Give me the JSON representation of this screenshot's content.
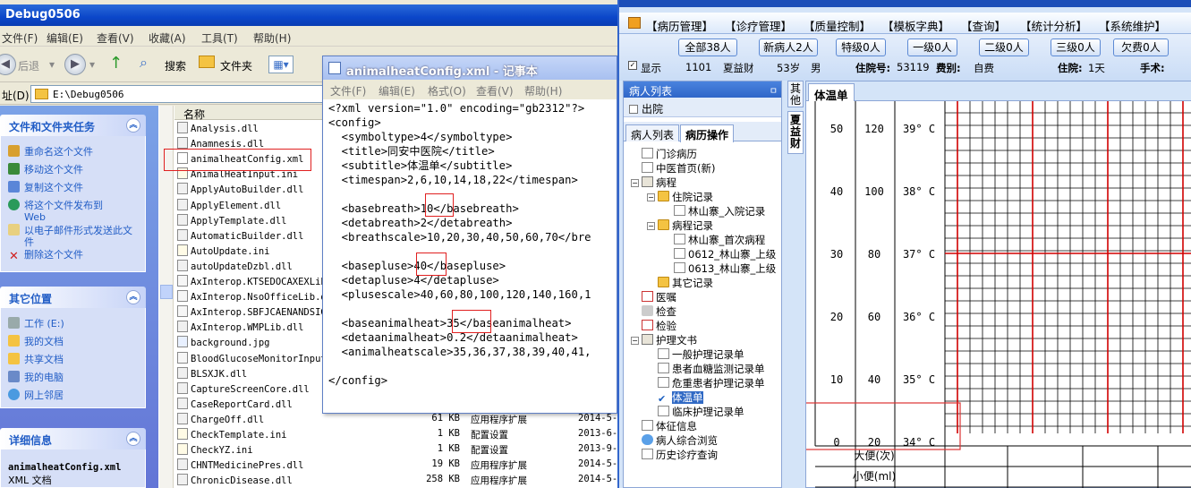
{
  "explorer": {
    "title": "Debug0506",
    "menu": [
      "文件(F)",
      "编辑(E)",
      "查看(V)",
      "收藏(A)",
      "工具(T)",
      "帮助(H)"
    ],
    "toolbar": {
      "back": "后退",
      "search": "搜索",
      "folders": "文件夹"
    },
    "address_label": "址(D)",
    "address": "E:\\Debug0506",
    "tasks": {
      "title": "文件和文件夹任务",
      "items": [
        "重命名这个文件",
        "移动这个文件",
        "复制这个文件",
        "将这个文件发布到Web",
        "以电子邮件形式发送此文件",
        "删除这个文件"
      ]
    },
    "places": {
      "title": "其它位置",
      "items": [
        "工作 (E:)",
        "我的文档",
        "共享文档",
        "我的电脑",
        "网上邻居"
      ]
    },
    "details": {
      "title": "详细信息",
      "filename": "animalheatConfig.xml",
      "filetype": "XML 文档"
    },
    "column_name": "名称",
    "files": [
      {
        "name": "Analysis.dll",
        "size": "",
        "type": "",
        "date": ""
      },
      {
        "name": "Anamnesis.dll",
        "size": "",
        "type": "",
        "date": ""
      },
      {
        "name": "animalheatConfig.xml",
        "size": "",
        "type": "",
        "date": ""
      },
      {
        "name": "AnimalHeatInput.ini",
        "size": "",
        "type": "",
        "date": ""
      },
      {
        "name": "ApplyAutoBuilder.dll",
        "size": "",
        "type": "",
        "date": ""
      },
      {
        "name": "ApplyElement.dll",
        "size": "",
        "type": "",
        "date": ""
      },
      {
        "name": "ApplyTemplate.dll",
        "size": "",
        "type": "",
        "date": ""
      },
      {
        "name": "AutomaticBuilder.dll",
        "size": "",
        "type": "",
        "date": ""
      },
      {
        "name": "AutoUpdate.ini",
        "size": "",
        "type": "",
        "date": ""
      },
      {
        "name": "autoUpdateDzbl.dll",
        "size": "",
        "type": "",
        "date": ""
      },
      {
        "name": "AxInterop.KTSEDOCAXEXLib",
        "size": "",
        "type": "",
        "date": ""
      },
      {
        "name": "AxInterop.NsoOfficeLib.d",
        "size": "",
        "type": "",
        "date": ""
      },
      {
        "name": "AxInterop.SBFJCAENANDSIG",
        "size": "",
        "type": "",
        "date": ""
      },
      {
        "name": "AxInterop.WMPLib.dll",
        "size": "",
        "type": "",
        "date": ""
      },
      {
        "name": "background.jpg",
        "size": "",
        "type": "",
        "date": ""
      },
      {
        "name": "BloodGlucoseMonitorInput",
        "size": "",
        "type": "",
        "date": ""
      },
      {
        "name": "BLSXJK.dll",
        "size": "",
        "type": "",
        "date": ""
      },
      {
        "name": "CaptureScreenCore.dll",
        "size": "",
        "type": "",
        "date": ""
      },
      {
        "name": "CaseReportCard.dll",
        "size": "",
        "type": "",
        "date": ""
      },
      {
        "name": "ChargeOff.dll",
        "size": "61 KB",
        "type": "应用程序扩展",
        "date": "2014-5-"
      },
      {
        "name": "CheckTemplate.ini",
        "size": "1 KB",
        "type": "配置设置",
        "date": "2013-6-"
      },
      {
        "name": "CheckYZ.ini",
        "size": "1 KB",
        "type": "配置设置",
        "date": "2013-9-"
      },
      {
        "name": "CHNTMedicinePres.dll",
        "size": "19 KB",
        "type": "应用程序扩展",
        "date": "2014-5-"
      },
      {
        "name": "ChronicDisease.dll",
        "size": "258 KB",
        "type": "应用程序扩展",
        "date": "2014-5-"
      }
    ]
  },
  "notepad": {
    "title": "animalheatConfig.xml - 记事本",
    "menu": [
      "文件(F)",
      "编辑(E)",
      "格式(O)",
      "查看(V)",
      "帮助(H)"
    ],
    "lines": [
      "<?xml version=\"1.0\" encoding=\"gb2312\"?>",
      "<config>",
      "  <symboltype>4</symboltype>",
      "  <title>同安中医院</title>",
      "  <subtitle>体温单</subtitle>",
      "  <timespan>2,6,10,14,18,22</timespan>",
      "",
      "  <basebreath>10</basebreath>",
      "  <detabreath>2</detabreath>",
      "  <breathscale>10,20,30,40,50,60,70</bre",
      "",
      "  <basepluse>40</basepluse>",
      "  <detapluse>4</detapluse>",
      "  <plusescale>40,60,80,100,120,140,160,1",
      "",
      "  <baseanimalheat>35</baseanimalheat>",
      "  <detaanimalheat>0.2</detaanimalheat>",
      "  <animalheatscale>35,36,37,38,39,40,41,",
      "",
      "</config>"
    ]
  },
  "app": {
    "menu": [
      "【病历管理】",
      "【诊疗管理】",
      "【质量控制】",
      "【模板字典】",
      "【查询】",
      "【统计分析】",
      "【系统维护】"
    ],
    "filters": [
      "全部38人",
      "新病人2人",
      "特级0人",
      "一级0人",
      "二级0人",
      "三级0人",
      "欠费0人"
    ],
    "patient": {
      "show_label": "显示",
      "bed": "1101",
      "name": "夏益财",
      "age": "53岁",
      "sex": "男",
      "inpatient_no_label": "住院号:",
      "inpatient_no": "53119",
      "fee_label": "费别:",
      "fee": "自费",
      "stay_label": "住院:",
      "stay": "1天",
      "surgery_label": "手术:"
    },
    "panel_title": "病人列表",
    "discharged": "出院",
    "tabs": [
      "病人列表",
      "病历操作"
    ],
    "tree": [
      "门诊病历",
      "中医首页(新)",
      "病程",
      "住院记录",
      "林山寨_入院记录",
      "病程记录",
      "林山寨_首次病程",
      "0612_林山寨_上级",
      "0613_林山寨_上级",
      "其它记录",
      "医嘱",
      "检查",
      "检验",
      "护理文书",
      "一般护理记录单",
      "患者血糖监测记录单",
      "危重患者护理记录单",
      "体温单",
      "临床护理记录单",
      "体征信息",
      "病人综合浏览",
      "历史诊疗查询"
    ],
    "side_tabs": [
      "其他",
      "夏益财"
    ],
    "chart_tab": "体温单"
  },
  "chart_data": {
    "type": "table",
    "title": "体温单",
    "columns": [
      "breath",
      "pulse",
      "temperature"
    ],
    "rows": [
      {
        "breath": "50",
        "pulse": "120",
        "temperature": "39° C"
      },
      {
        "breath": "40",
        "pulse": "100",
        "temperature": "38° C"
      },
      {
        "breath": "30",
        "pulse": "80",
        "temperature": "37° C"
      },
      {
        "breath": "20",
        "pulse": "60",
        "temperature": "36° C"
      },
      {
        "breath": "10",
        "pulse": "40",
        "temperature": "35° C"
      },
      {
        "breath": "0",
        "pulse": "20",
        "temperature": "34° C"
      }
    ],
    "footer_rows": [
      "大便(次)",
      "小便(ml)"
    ],
    "grid": true,
    "colors": {
      "grid": "#000000",
      "day_divider": "#d00000",
      "normal_temp_line": "#d00000"
    }
  }
}
